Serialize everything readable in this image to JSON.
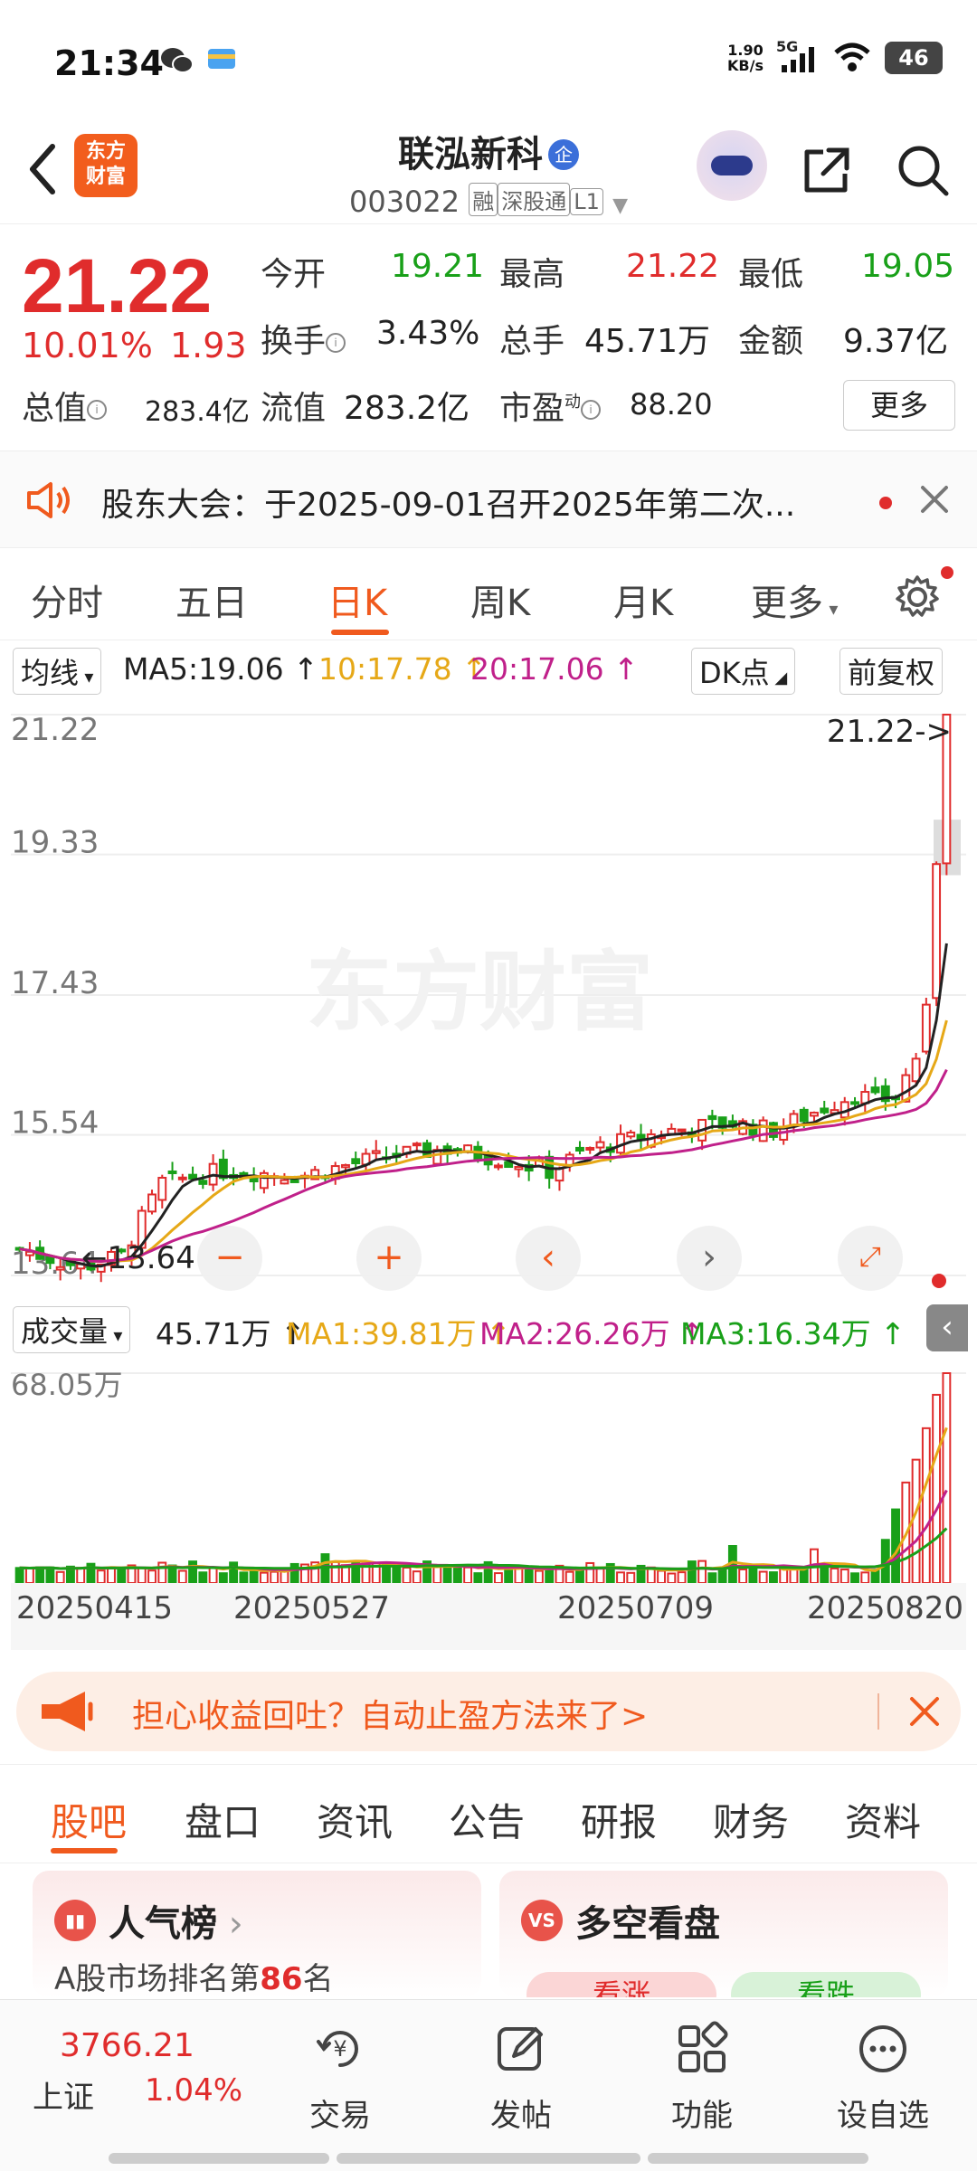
{
  "status_bar": {
    "time": "21:34",
    "net_speed_value": "1.90",
    "net_speed_unit": "KB/s",
    "network": "5G",
    "battery": "46"
  },
  "header": {
    "logo_line1": "东方",
    "logo_line2": "财富",
    "stock_name": "联泓新科",
    "badge": "企",
    "stock_code": "003022",
    "tags": [
      "融",
      "深股通",
      "L1"
    ]
  },
  "quote": {
    "price": "21.22",
    "change_pct": "10.01%",
    "change": "1.93",
    "market_cap_label": "总值",
    "market_cap": "283.4亿",
    "open_label": "今开",
    "open": "19.21",
    "high_label": "最高",
    "high": "21.22",
    "low_label": "最低",
    "low": "19.05",
    "turnover_label": "换手",
    "turnover": "3.43%",
    "volume_label": "总手",
    "volume": "45.71万",
    "amount_label": "金额",
    "amount": "9.37亿",
    "float_cap_label": "流值",
    "float_cap": "283.2亿",
    "pe_label": "市盈",
    "pe_sup": "动",
    "pe": "88.20",
    "more_button": "更多"
  },
  "notice": {
    "text": "股东大会：于2025-09-01召开2025年第二次..."
  },
  "period_tabs": [
    "分时",
    "五日",
    "日K",
    "周K",
    "月K",
    "更多"
  ],
  "active_period": "日K",
  "ma_bar": {
    "ma_select": "均线",
    "ma5": "MA5:19.06",
    "ma10": "10:17.78",
    "ma20": "20:17.06",
    "dk_button": "DK点",
    "adjust_button": "前复权"
  },
  "chart_data": [
    {
      "type": "candlestick",
      "title": "",
      "y_ticks": [
        "21.22",
        "19.33",
        "17.43",
        "15.54",
        "13.64"
      ],
      "ylim": [
        13.64,
        21.22
      ],
      "max_marker": "21.22->",
      "min_marker": "13.64",
      "last_close": 21.22,
      "ma_colors": {
        "ma5": "#222222",
        "ma10": "#e6a817",
        "ma20": "#c0208a"
      },
      "up_color": "#e02c2c",
      "down_color": "#19a019",
      "watermark": "东方财富"
    },
    {
      "type": "bar",
      "title": "成交量",
      "y_max_label": "68.05万",
      "current": "45.71万",
      "ma1": "MA1:39.81万",
      "ma2": "MA2:26.26万",
      "ma3": "MA3:16.34万",
      "dates": [
        "20250415",
        "20250527",
        "20250709",
        "20250820"
      ]
    }
  ],
  "volume_bar": {
    "select_label": "成交量",
    "current": "45.71万",
    "ma1": "MA1:39.81万",
    "ma2": "MA2:26.26万",
    "ma3": "MA3:16.34万",
    "y_max": "68.05万"
  },
  "dates": [
    "20250415",
    "20250527",
    "20250709",
    "20250820"
  ],
  "promo": {
    "text": "担心收益回吐？自动止盈方法来了>"
  },
  "section_tabs": [
    "股吧",
    "盘口",
    "资讯",
    "公告",
    "研报",
    "财务",
    "资料"
  ],
  "active_section": "股吧",
  "cards": {
    "popularity_title": "人气榜",
    "popularity_prefix": "A股市场排名第",
    "popularity_rank": "86",
    "popularity_suffix": "名",
    "bullbear_title": "多空看盘",
    "bull_label": "看涨",
    "bear_label": "看跌"
  },
  "bottom_nav": {
    "index_value": "3766.21",
    "index_name": "上证",
    "index_pct": "1.04%",
    "trade": "交易",
    "post": "发帖",
    "function": "功能",
    "add_watch": "设自选"
  }
}
